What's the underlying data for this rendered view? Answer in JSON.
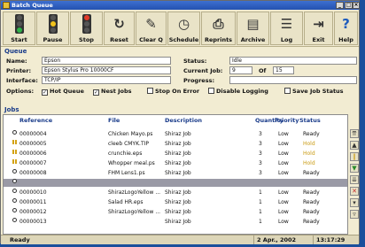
{
  "window": {
    "title": "Batch Queue"
  },
  "toolbar": [
    {
      "label": "Start",
      "icon": "traffic-light-green-icon"
    },
    {
      "label": "Pause",
      "icon": "traffic-light-yellow-icon"
    },
    {
      "label": "Stop",
      "icon": "traffic-light-red-icon"
    },
    {
      "label": "Reset",
      "icon": "reset-icon"
    },
    {
      "label": "Clear Q",
      "icon": "clear-queue-icon"
    },
    {
      "label": "Schedule",
      "icon": "clock-icon"
    },
    {
      "label": "Reprints",
      "icon": "printer-icon"
    },
    {
      "label": "Archive",
      "icon": "archive-icon"
    },
    {
      "label": "Log",
      "icon": "log-icon"
    },
    {
      "label": "Exit",
      "icon": "exit-icon"
    },
    {
      "label": "Help",
      "icon": "help-icon"
    }
  ],
  "queue": {
    "section_label": "Queue",
    "name_label": "Name:",
    "name_value": "Epson",
    "printer_label": "Printer:",
    "printer_value": "Epson Stylus Pro 10000CF",
    "interface_label": "Interface:",
    "interface_value": "TCP/IP",
    "status_label": "Status:",
    "status_value": "Idle",
    "current_job_label": "Current Job:",
    "current_job_value": "9",
    "of_label": "Of",
    "of_value": "15",
    "progress_label": "Progress:",
    "options_label": "Options:",
    "options": [
      {
        "label": "Hot Queue",
        "checked": true
      },
      {
        "label": "Nest Jobs",
        "checked": true
      },
      {
        "label": "Stop On Error",
        "checked": false
      },
      {
        "label": "Disable Logging",
        "checked": false
      },
      {
        "label": "Save Job Status",
        "checked": false
      }
    ]
  },
  "jobs": {
    "section_label": "Jobs",
    "columns": [
      "Reference",
      "File",
      "Description",
      "Quantity",
      "Priority",
      "Status"
    ],
    "rows": [
      {
        "icon": "dot",
        "reference": "00000004",
        "file": "Chicken Mayo.ps",
        "description": "Shiraz Job",
        "quantity": "3",
        "priority": "Low",
        "status": "Ready",
        "selected": false
      },
      {
        "icon": "hold",
        "reference": "00000005",
        "file": "cleeb CMYK.TIP",
        "description": "Shiraz Job",
        "quantity": "3",
        "priority": "Low",
        "status": "Hold",
        "selected": false
      },
      {
        "icon": "hold",
        "reference": "00000006",
        "file": "crunchie.eps",
        "description": "Shiraz Job",
        "quantity": "3",
        "priority": "Low",
        "status": "Hold",
        "selected": false
      },
      {
        "icon": "hold",
        "reference": "00000007",
        "file": "Whopper meal.ps",
        "description": "Shiraz Job",
        "quantity": "3",
        "priority": "Low",
        "status": "Hold",
        "selected": false
      },
      {
        "icon": "dot",
        "reference": "00000008",
        "file": "FHM Lens1.ps",
        "description": "Shiraz Job",
        "quantity": "3",
        "priority": "Low",
        "status": "Ready",
        "selected": false
      },
      {
        "icon": "dot",
        "reference": "",
        "file": "",
        "description": "",
        "quantity": "",
        "priority": "",
        "status": "",
        "selected": true
      },
      {
        "icon": "dot",
        "reference": "00000010",
        "file": "ShirazLogoYellow ...",
        "description": "Shiraz Job",
        "quantity": "1",
        "priority": "Low",
        "status": "Ready",
        "selected": false
      },
      {
        "icon": "dot",
        "reference": "00000011",
        "file": "Salad HR.eps",
        "description": "Shiraz Job",
        "quantity": "1",
        "priority": "Low",
        "status": "Ready",
        "selected": false
      },
      {
        "icon": "dot",
        "reference": "00000012",
        "file": "ShirazLogoYellow ...",
        "description": "Shiraz Job",
        "quantity": "1",
        "priority": "Low",
        "status": "Ready",
        "selected": false
      },
      {
        "icon": "dot",
        "reference": "00000013",
        "file": "",
        "description": "Shiraz Job",
        "quantity": "1",
        "priority": "Low",
        "status": "Ready",
        "selected": false
      }
    ]
  },
  "statusbar": {
    "state": "Ready",
    "date": "2 Apr., 2002",
    "time": "13:17:29"
  },
  "colors": {
    "hold": "#c99a10",
    "selected_row": "#9a9aa6",
    "section": "#1a3c8a"
  }
}
